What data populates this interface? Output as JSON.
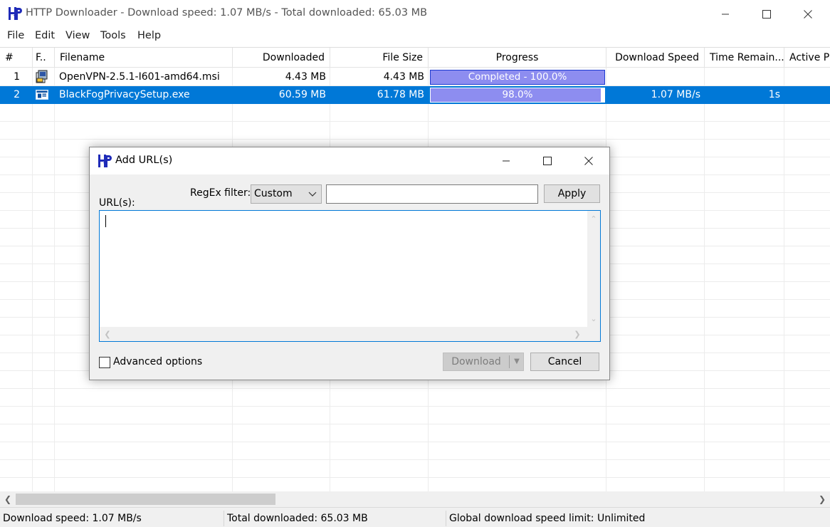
{
  "window": {
    "title": "HTTP Downloader - Download speed: 1.07 MB/s - Total downloaded: 65.03 MB",
    "minimize_icon": "minimize-icon",
    "maximize_icon": "maximize-icon",
    "close_icon": "close-icon"
  },
  "menu": {
    "file": "File",
    "edit": "Edit",
    "view": "View",
    "tools": "Tools",
    "help": "Help"
  },
  "columns": {
    "num": "#",
    "file_type": "F..",
    "filename": "Filename",
    "downloaded": "Downloaded",
    "file_size": "File Size",
    "progress": "Progress",
    "download_speed": "Download Speed",
    "time_remaining": "Time Remain...",
    "active_parts": "Active P"
  },
  "rows": [
    {
      "num": "1",
      "filename": "OpenVPN-2.5.1-I601-amd64.msi",
      "downloaded": "4.43 MB",
      "file_size": "4.43 MB",
      "progress_label": "Completed - 100.0%",
      "progress_value": 1.0,
      "download_speed": "",
      "time_remaining": "",
      "icon": "msi-installer-icon"
    },
    {
      "num": "2",
      "filename": "BlackFogPrivacySetup.exe",
      "downloaded": "60.59 MB",
      "file_size": "61.78 MB",
      "progress_label": "98.0%",
      "progress_value": 0.98,
      "download_speed": "1.07 MB/s",
      "time_remaining": "1s",
      "icon": "exe-file-icon"
    }
  ],
  "status": {
    "speed": "Download speed: 1.07 MB/s",
    "total": "Total downloaded: 65.03 MB",
    "limit": "Global download speed limit: Unlimited"
  },
  "dialog": {
    "title": "Add URL(s)",
    "regex_label": "RegEx filter:",
    "regex_selected": "Custom",
    "regex_value": "",
    "apply_label": "Apply",
    "urls_label": "URL(s):",
    "urls_value": "",
    "advanced_label": "Advanced options",
    "download_label": "Download",
    "cancel_label": "Cancel"
  },
  "colors": {
    "selection": "#0078d7",
    "progress_fill": "#8d8df0",
    "progress_border": "#1f3cd1"
  }
}
